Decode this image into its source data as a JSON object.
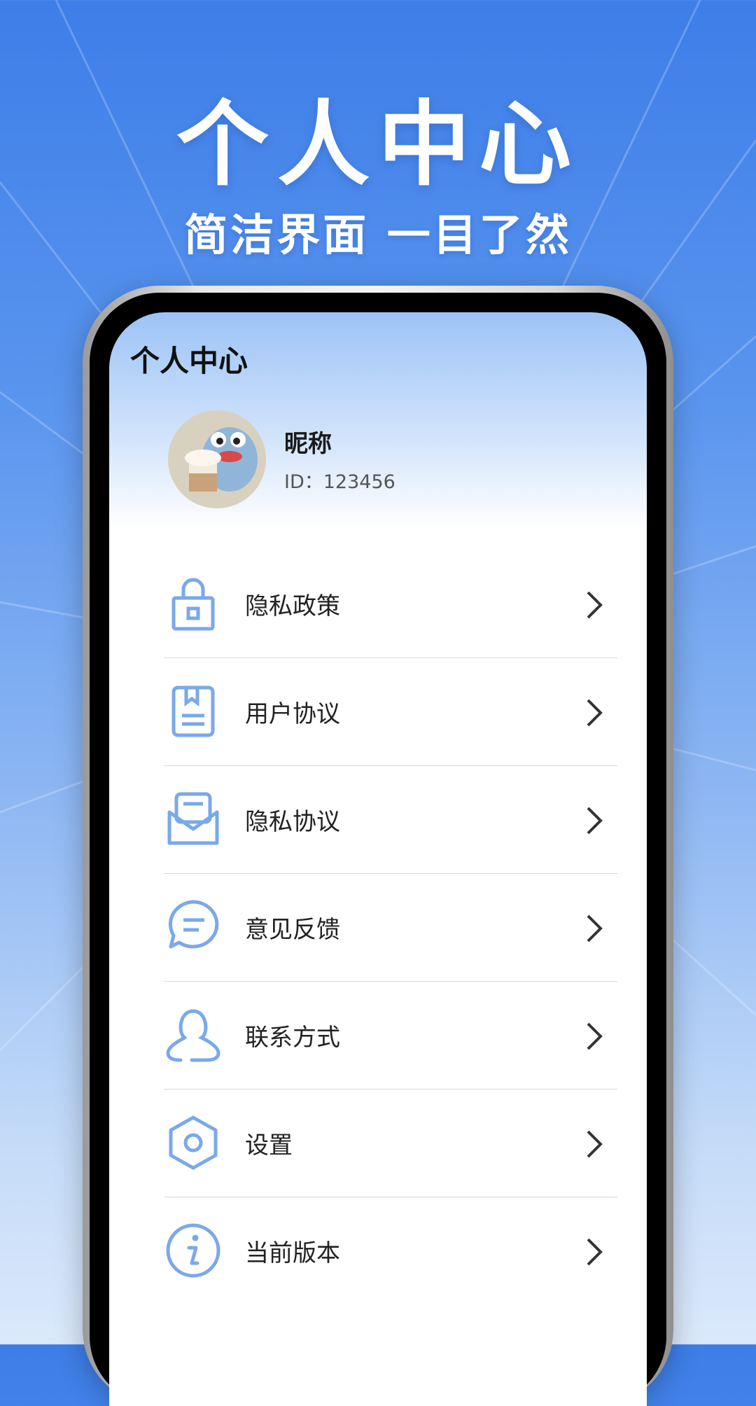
{
  "promo": {
    "title": "个人中心",
    "subtitle": "简洁界面 一目了然"
  },
  "screen": {
    "title": "个人中心"
  },
  "profile": {
    "nickname": "昵称",
    "id_text": "ID：123456"
  },
  "menu": {
    "items": [
      {
        "label": "隐私政策",
        "icon": "lock-icon"
      },
      {
        "label": "用户协议",
        "icon": "bookmark-document-icon"
      },
      {
        "label": "隐私协议",
        "icon": "envelope-icon"
      },
      {
        "label": "意见反馈",
        "icon": "chat-bubble-icon"
      },
      {
        "label": "联系方式",
        "icon": "person-icon"
      },
      {
        "label": "设置",
        "icon": "hexagon-gear-icon"
      },
      {
        "label": "当前版本",
        "icon": "info-icon"
      }
    ]
  },
  "colors": {
    "icon_blue": "#7aa9ea",
    "background_top": "#3d7ee8",
    "background_bottom": "#dbe9fb"
  }
}
